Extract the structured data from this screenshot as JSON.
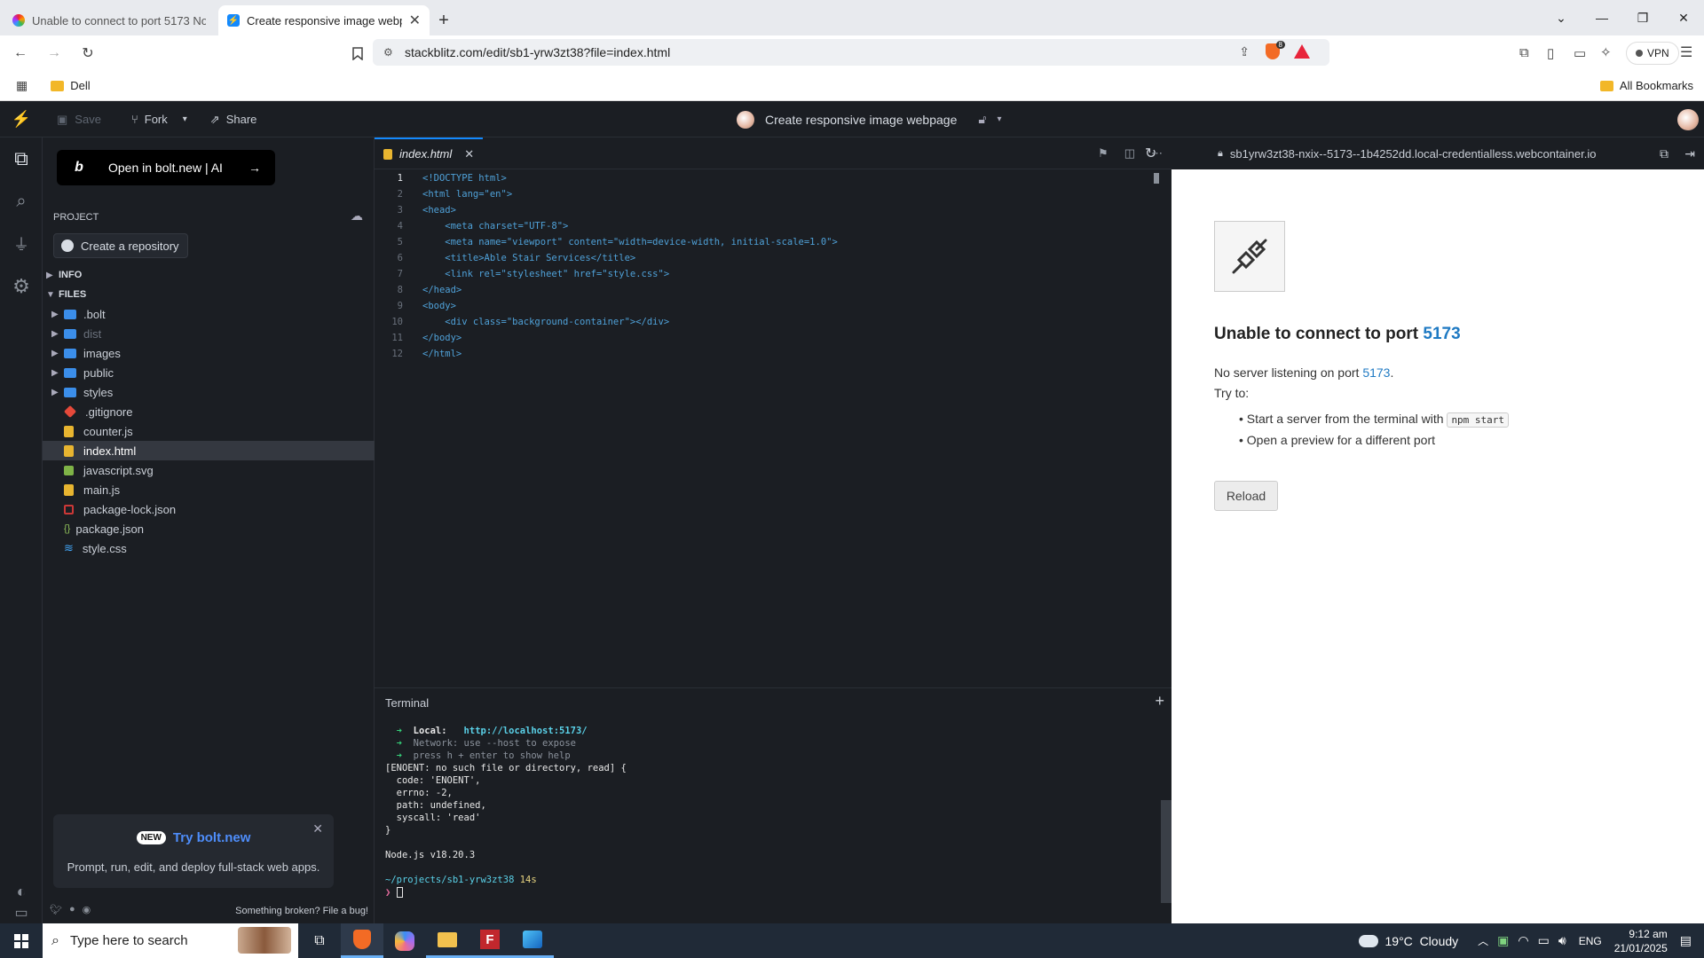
{
  "browser": {
    "tabs": [
      {
        "title": "Unable to connect to port 5173 No"
      },
      {
        "title": "Create responsive image webp"
      }
    ],
    "url": "stackblitz.com/edit/sb1-yrw3zt38?file=index.html",
    "vpn_label": "VPN",
    "brave_badge": "8",
    "bookmarks": {
      "left": "Dell",
      "right": "All Bookmarks"
    }
  },
  "app": {
    "save_label": "Save",
    "fork_label": "Fork",
    "share_label": "Share",
    "project_title": "Create responsive image webpage"
  },
  "sidebar": {
    "bolt_button": "Open in bolt.new | AI",
    "project_heading": "PROJECT",
    "create_repo": "Create a repository",
    "info_heading": "INFO",
    "files_heading": "FILES",
    "files": [
      {
        "name": ".bolt",
        "type": "folder"
      },
      {
        "name": "dist",
        "type": "folder"
      },
      {
        "name": "images",
        "type": "folder"
      },
      {
        "name": "public",
        "type": "folder"
      },
      {
        "name": "styles",
        "type": "folder"
      },
      {
        "name": ".gitignore",
        "type": "git"
      },
      {
        "name": "counter.js",
        "type": "js"
      },
      {
        "name": "index.html",
        "type": "html"
      },
      {
        "name": "javascript.svg",
        "type": "svg"
      },
      {
        "name": "main.js",
        "type": "js"
      },
      {
        "name": "package-lock.json",
        "type": "lock"
      },
      {
        "name": "package.json",
        "type": "json"
      },
      {
        "name": "style.css",
        "type": "css"
      }
    ],
    "promo": {
      "badge": "NEW",
      "title": "Try bolt.new",
      "text": "Prompt, run, edit, and deploy full-stack web apps."
    },
    "footer_link": "Something broken? File a bug!"
  },
  "editor": {
    "tab_name": "index.html",
    "preview_url": "sb1yrw3zt38-nxix--5173--1b4252dd.local-credentialless.webcontainer.io",
    "lines": [
      "<!DOCTYPE html>",
      "<html lang=\"en\">",
      "<head>",
      "    <meta charset=\"UTF-8\">",
      "    <meta name=\"viewport\" content=\"width=device-width, initial-scale=1.0\">",
      "    <title>Able Stair Services</title>",
      "    <link rel=\"stylesheet\" href=\"style.css\">",
      "</head>",
      "<body>",
      "    <div class=\"background-container\"></div>",
      "</body>",
      "</html>"
    ]
  },
  "terminal": {
    "title": "Terminal",
    "local_label": "Local:",
    "local_url": "http://localhost:5173/",
    "network_line": "Network: use --host to expose",
    "help_line": "press h + enter to show help",
    "error_lines": [
      "[ENOENT: no such file or directory, read] {",
      "  code: 'ENOENT',",
      "  errno: -2,",
      "  path: undefined,",
      "  syscall: 'read'",
      "}"
    ],
    "node_version": "Node.js v18.20.3",
    "prompt_path": "~/projects/sb1-yrw3zt38",
    "prompt_time": "14s"
  },
  "preview": {
    "heading_prefix": "Unable to connect to port",
    "port": "5173",
    "message_prefix": "No server listening on port",
    "message_suffix": ".",
    "try_to": "Try to:",
    "bullet1_prefix": "Start a server from the terminal with",
    "bullet1_code": "npm start",
    "bullet2": "Open a preview for a different port",
    "reload_label": "Reload"
  },
  "taskbar": {
    "search_placeholder": "Type here to search",
    "weather": "19°C  Cloudy",
    "lang": "ENG",
    "time": "9:12 am",
    "date": "21/01/2025"
  }
}
